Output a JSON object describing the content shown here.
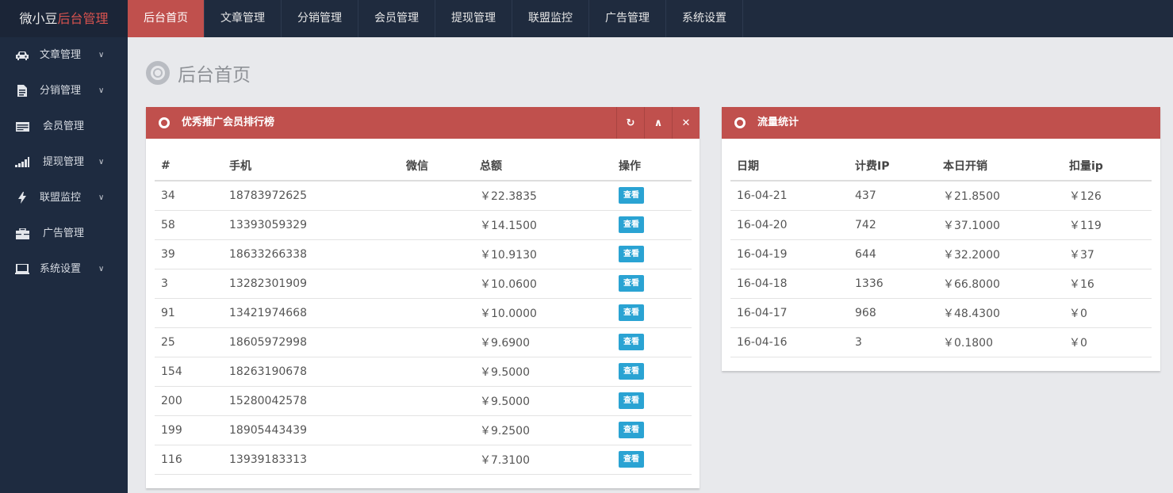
{
  "brand": {
    "prefix": "微小豆",
    "accent": "后台管理"
  },
  "topnav": [
    {
      "label": "后台首页",
      "active": true
    },
    {
      "label": "文章管理"
    },
    {
      "label": "分销管理"
    },
    {
      "label": "会员管理"
    },
    {
      "label": "提现管理"
    },
    {
      "label": "联盟监控"
    },
    {
      "label": "广告管理"
    },
    {
      "label": "系统设置"
    }
  ],
  "sidebar": [
    {
      "label": "文章管理",
      "icon": "car-icon",
      "has_children": true
    },
    {
      "label": "分销管理",
      "icon": "document-icon",
      "has_children": true
    },
    {
      "label": "会员管理",
      "icon": "card-icon",
      "has_children": false
    },
    {
      "label": "提现管理",
      "icon": "signal-icon",
      "has_children": true
    },
    {
      "label": "联盟监控",
      "icon": "bolt-icon",
      "has_children": true
    },
    {
      "label": "广告管理",
      "icon": "briefcase-icon",
      "has_children": false
    },
    {
      "label": "系统设置",
      "icon": "laptop-icon",
      "has_children": true
    }
  ],
  "page": {
    "title": "后台首页"
  },
  "ranking": {
    "title": "优秀推广会员排行榜",
    "columns": [
      "#",
      "手机",
      "微信",
      "总额",
      "操作"
    ],
    "view_label": "查看",
    "rows": [
      {
        "id": "34",
        "phone": "18783972625",
        "wechat": "",
        "total": "￥22.3835"
      },
      {
        "id": "58",
        "phone": "13393059329",
        "wechat": "",
        "total": "￥14.1500"
      },
      {
        "id": "39",
        "phone": "18633266338",
        "wechat": "",
        "total": "￥10.9130"
      },
      {
        "id": "3",
        "phone": "13282301909",
        "wechat": "",
        "total": "￥10.0600"
      },
      {
        "id": "91",
        "phone": "13421974668",
        "wechat": "",
        "total": "￥10.0000"
      },
      {
        "id": "25",
        "phone": "18605972998",
        "wechat": "",
        "total": "￥9.6900"
      },
      {
        "id": "154",
        "phone": "18263190678",
        "wechat": "",
        "total": "￥9.5000"
      },
      {
        "id": "200",
        "phone": "15280042578",
        "wechat": "",
        "total": "￥9.5000"
      },
      {
        "id": "199",
        "phone": "18905443439",
        "wechat": "",
        "total": "￥9.2500"
      },
      {
        "id": "116",
        "phone": "13939183313",
        "wechat": "",
        "total": "￥7.3100"
      }
    ]
  },
  "traffic": {
    "title": "流量统计",
    "columns": [
      "日期",
      "计费IP",
      "本日开销",
      "扣量ip"
    ],
    "rows": [
      {
        "date": "16-04-21",
        "ip": "437",
        "cost": "￥21.8500",
        "deduct": "￥126"
      },
      {
        "date": "16-04-20",
        "ip": "742",
        "cost": "￥37.1000",
        "deduct": "￥119"
      },
      {
        "date": "16-04-19",
        "ip": "644",
        "cost": "￥32.2000",
        "deduct": "￥37"
      },
      {
        "date": "16-04-18",
        "ip": "1336",
        "cost": "￥66.8000",
        "deduct": "￥16"
      },
      {
        "date": "16-04-17",
        "ip": "968",
        "cost": "￥48.4300",
        "deduct": "￥0"
      },
      {
        "date": "16-04-16",
        "ip": "3",
        "cost": "￥0.1800",
        "deduct": "￥0"
      }
    ]
  },
  "colors": {
    "accent": "#c0504d",
    "topbar": "#1f2b3e",
    "sidebar": "#1e2b40",
    "button": "#2aa3d3"
  }
}
